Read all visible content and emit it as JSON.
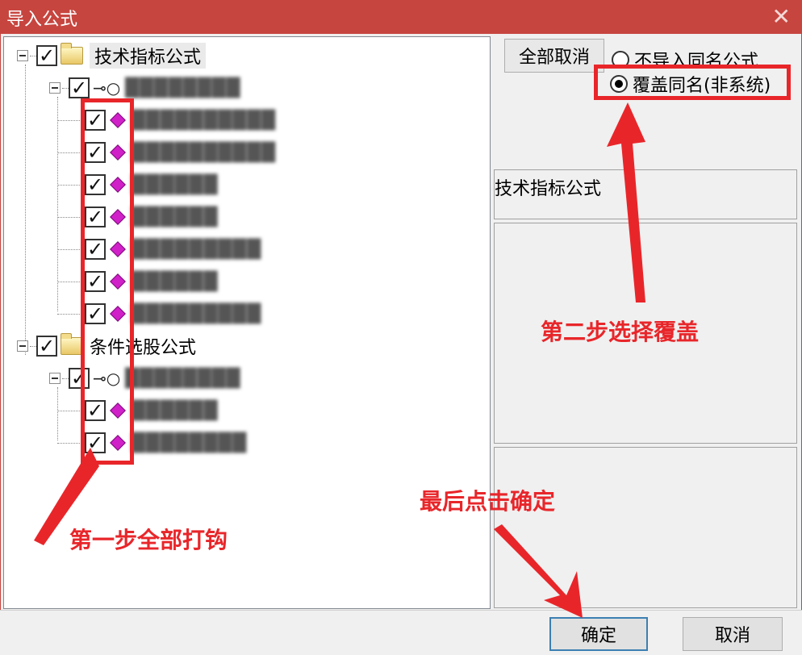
{
  "window": {
    "title": "导入公式",
    "close_glyph": "✕"
  },
  "tree": {
    "groups": [
      {
        "label": "技术指标公式",
        "checked": true,
        "sub": {
          "label": "████████",
          "items": [
            "██████████",
            "██████████",
            "██████",
            "██████",
            "█████████",
            "██████",
            "█████████"
          ]
        }
      },
      {
        "label": "条件选股公式",
        "checked": true,
        "sub": {
          "label": "████████",
          "items": [
            "██████",
            "████████"
          ]
        }
      }
    ],
    "check_glyph": "✓"
  },
  "right_panel": {
    "cancel_all_label": "全部取消",
    "radio_options": [
      {
        "label": "不导入同名公式",
        "selected": false
      },
      {
        "label": "覆盖同名(非系统)",
        "selected": true
      }
    ],
    "selected_category": "技术指标公式"
  },
  "annotations": {
    "step1": "第一步全部打钩",
    "step2": "第二步选择覆盖",
    "step3": "最后点击确定"
  },
  "buttons": {
    "ok": "确定",
    "cancel": "取消"
  },
  "colors": {
    "titlebar": "#c7453f",
    "annotation": "#e8262a",
    "gem": "#d020c8"
  }
}
